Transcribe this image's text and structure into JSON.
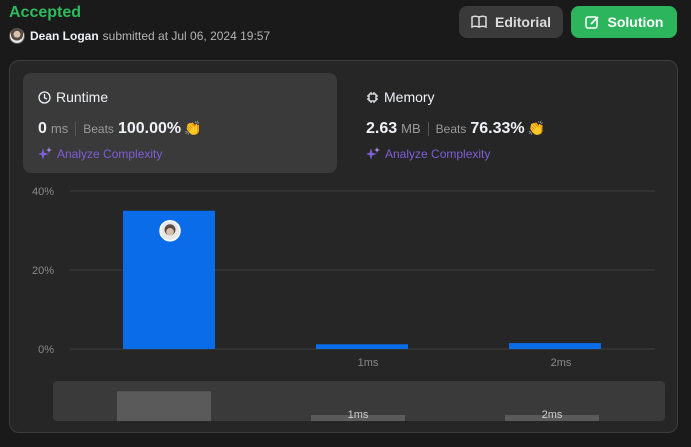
{
  "header": {
    "status": "Accepted",
    "user": "Dean Logan",
    "submitted_text": "submitted at Jul 06, 2024 19:57",
    "editorial_label": "Editorial",
    "solution_label": "Solution",
    "colors": {
      "accepted": "#2cbb5d",
      "solution_bg": "#2db55d",
      "editorial_bg": "#3a3a3a"
    }
  },
  "runtime": {
    "title": "Runtime",
    "value": "0",
    "unit": "ms",
    "beats_label": "Beats",
    "beats_value": "100.00%",
    "analyze_label": "Analyze Complexity",
    "icon": "clock-icon"
  },
  "memory": {
    "title": "Memory",
    "value": "2.63",
    "unit": "MB",
    "beats_label": "Beats",
    "beats_value": "76.33%",
    "analyze_label": "Analyze Complexity",
    "icon": "chip-icon"
  },
  "chart_data": {
    "type": "bar",
    "categories": [
      "",
      "1ms",
      "2ms"
    ],
    "values": [
      35,
      1.2,
      1.5
    ],
    "yticks": [
      "40%",
      "20%",
      "0%"
    ],
    "ylim": [
      0,
      40
    ],
    "grid": true,
    "bar_color": "#0a6ce8",
    "highlight_index": 0,
    "minimap": {
      "categories": [
        "",
        "1ms",
        "2ms"
      ],
      "values": [
        35,
        1.2,
        1.5
      ],
      "bar_color": "#5a5a5a"
    }
  }
}
